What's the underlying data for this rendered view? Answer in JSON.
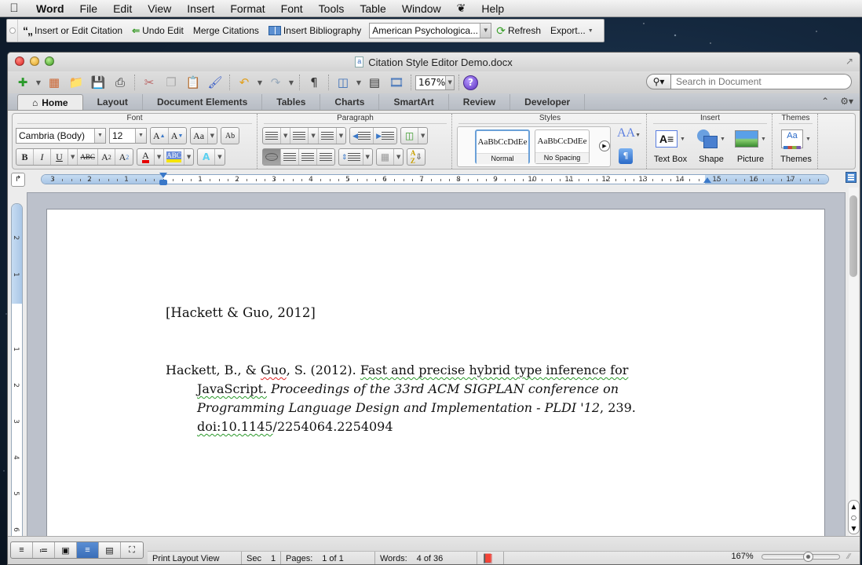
{
  "menubar": {
    "app": "Word",
    "items": [
      "File",
      "Edit",
      "View",
      "Insert",
      "Format",
      "Font",
      "Tools",
      "Table",
      "Window",
      "Help"
    ]
  },
  "citation_toolbar": {
    "insert_edit": "Insert or Edit Citation",
    "undo_edit": "Undo Edit",
    "merge": "Merge Citations",
    "insert_bibliography": "Insert Bibliography",
    "style_select": "American Psychologica...",
    "refresh": "Refresh",
    "export": "Export..."
  },
  "window": {
    "title": "Citation Style Editor Demo.docx"
  },
  "standard_toolbar": {
    "zoom": "167%",
    "search_placeholder": "Search in Document"
  },
  "ribbon": {
    "tabs": [
      "Home",
      "Layout",
      "Document Elements",
      "Tables",
      "Charts",
      "SmartArt",
      "Review",
      "Developer"
    ],
    "active_tab": "Home",
    "groups": {
      "font": "Font",
      "paragraph": "Paragraph",
      "styles": "Styles",
      "insert": "Insert",
      "themes": "Themes"
    },
    "font_name": "Cambria (Body)",
    "font_size": "12",
    "styles": [
      {
        "preview": "AaBbCcDdEe",
        "name": "Normal",
        "selected": true
      },
      {
        "preview": "AaBbCcDdEe",
        "name": "No Spacing",
        "selected": false
      }
    ],
    "insert_buttons": [
      "Text Box",
      "Shape",
      "Picture"
    ],
    "themes_button": "Themes",
    "colors": {
      "font_color": "#e60000",
      "highlight_color": "#f5e400"
    }
  },
  "ruler": {
    "left_numbers": [
      "3",
      "2",
      "1"
    ],
    "right_numbers": [
      "1",
      "2",
      "3",
      "4",
      "5",
      "6",
      "7",
      "8",
      "9",
      "10",
      "11",
      "12",
      "13",
      "14",
      "15",
      "16",
      "17"
    ],
    "vertical_numbers": [
      "2",
      "1",
      "1",
      "2",
      "3",
      "4",
      "5",
      "6"
    ]
  },
  "document": {
    "citation": "[Hackett & Guo, 2012]",
    "bibliography": {
      "authors_pre": "Hackett, B., & ",
      "author_guo": "Guo",
      "authors_post": ", S. (2012). ",
      "title": "Fast and precise hybrid type inference for JavaScript.",
      "venue": " Proceedings of the 33rd ACM SIGPLAN conference on Programming Language Design and Implementation - PLDI  '12",
      "pages": ", 239. ",
      "doi_prefix": "doi:10.1145",
      "doi_rest": "/2254064.2254094"
    }
  },
  "statusbar": {
    "view": "Print Layout View",
    "sec_label": "Sec",
    "sec_value": "1",
    "pages_label": "Pages:",
    "pages_value": "1 of 1",
    "words_label": "Words:",
    "words_value": "4 of 36",
    "zoom": "167%",
    "zoom_slider_fraction": 0.6
  }
}
